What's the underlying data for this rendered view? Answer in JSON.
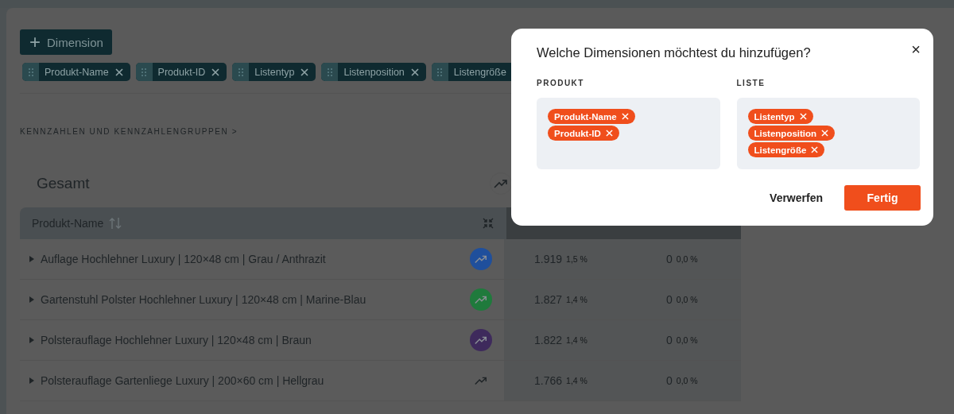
{
  "toolbar": {
    "add_button": {
      "icon": "+",
      "label": "Dimension"
    },
    "chips": [
      {
        "label": "Produkt-Name"
      },
      {
        "label": "Produkt-ID"
      },
      {
        "label": "Listentyp"
      },
      {
        "label": "Listenposition"
      },
      {
        "label": "Listengröße"
      }
    ]
  },
  "section_link": {
    "label": "KENNZAHLEN UND KENNZAHLENGRUPPEN",
    "chevron": ">"
  },
  "panel": {
    "title": "Gesamt"
  },
  "table": {
    "columns": [
      {
        "label": "Produkt-Name"
      }
    ],
    "rows": [
      {
        "name": "Auflage Hochlehner Luxury | 120×48 cm | Grau / Anthrazit",
        "color": "#1f4f9c",
        "value_1": "1.919",
        "share_1": "1,5 %",
        "value_2": "0",
        "share_2": "0,0 %"
      },
      {
        "name": "Gartenstuhl Polster Hochlehner Luxury | 120×48 cm | Marine-Blau",
        "color": "#1f7a3c",
        "value_1": "1.827",
        "share_1": "1,4 %",
        "value_2": "0",
        "share_2": "0,0 %"
      },
      {
        "name": "Polsterauflage Hochlehner Luxury | 120×48 cm | Braun",
        "color": "#3e2a5c",
        "value_1": "1.822",
        "share_1": "1,4 %",
        "value_2": "0",
        "share_2": "0,0 %"
      },
      {
        "name": "Polsterauflage Gartenliege Luxury | 200×60 cm | Hellgrau",
        "value_1": "1.766",
        "share_1": "1,4 %",
        "value_2": "0",
        "share_2": "0,0 %"
      }
    ]
  },
  "dialog": {
    "title": "Welche Dimensionen möchtest du hinzufügen?",
    "close": "×",
    "groups": [
      {
        "label": "PRODUKT",
        "tags": [
          "Produkt-Name",
          "Produkt-ID"
        ]
      },
      {
        "label": "LISTE",
        "tags": [
          "Listentyp",
          "Listenposition",
          "Listengröße"
        ]
      }
    ],
    "buttons": [
      {
        "label": "Verwerfen",
        "kind": "secondary"
      },
      {
        "label": "Fertig",
        "kind": "primary"
      }
    ]
  }
}
